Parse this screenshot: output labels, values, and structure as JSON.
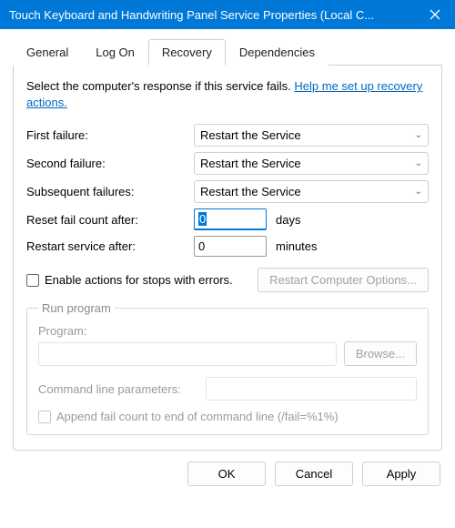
{
  "window": {
    "title": "Touch Keyboard and Handwriting Panel Service Properties (Local C..."
  },
  "tabs": {
    "general": "General",
    "logon": "Log On",
    "recovery": "Recovery",
    "dependencies": "Dependencies"
  },
  "intro": {
    "text": "Select the computer's response if this service fails. ",
    "link": "Help me set up recovery actions."
  },
  "rows": {
    "first_label": "First failure:",
    "first_value": "Restart the Service",
    "second_label": "Second failure:",
    "second_value": "Restart the Service",
    "subsequent_label": "Subsequent failures:",
    "subsequent_value": "Restart the Service",
    "reset_label": "Reset fail count after:",
    "reset_value": "0",
    "reset_unit": "days",
    "restart_label": "Restart service after:",
    "restart_value": "0",
    "restart_unit": "minutes"
  },
  "enable_actions": {
    "label": "Enable actions for stops with errors.",
    "restart_computer_btn": "Restart Computer Options..."
  },
  "run_program": {
    "legend": "Run program",
    "program_label": "Program:",
    "browse": "Browse...",
    "cmd_params_label": "Command line parameters:",
    "append_label": "Append fail count to end of command line (/fail=%1%)"
  },
  "footer": {
    "ok": "OK",
    "cancel": "Cancel",
    "apply": "Apply"
  }
}
